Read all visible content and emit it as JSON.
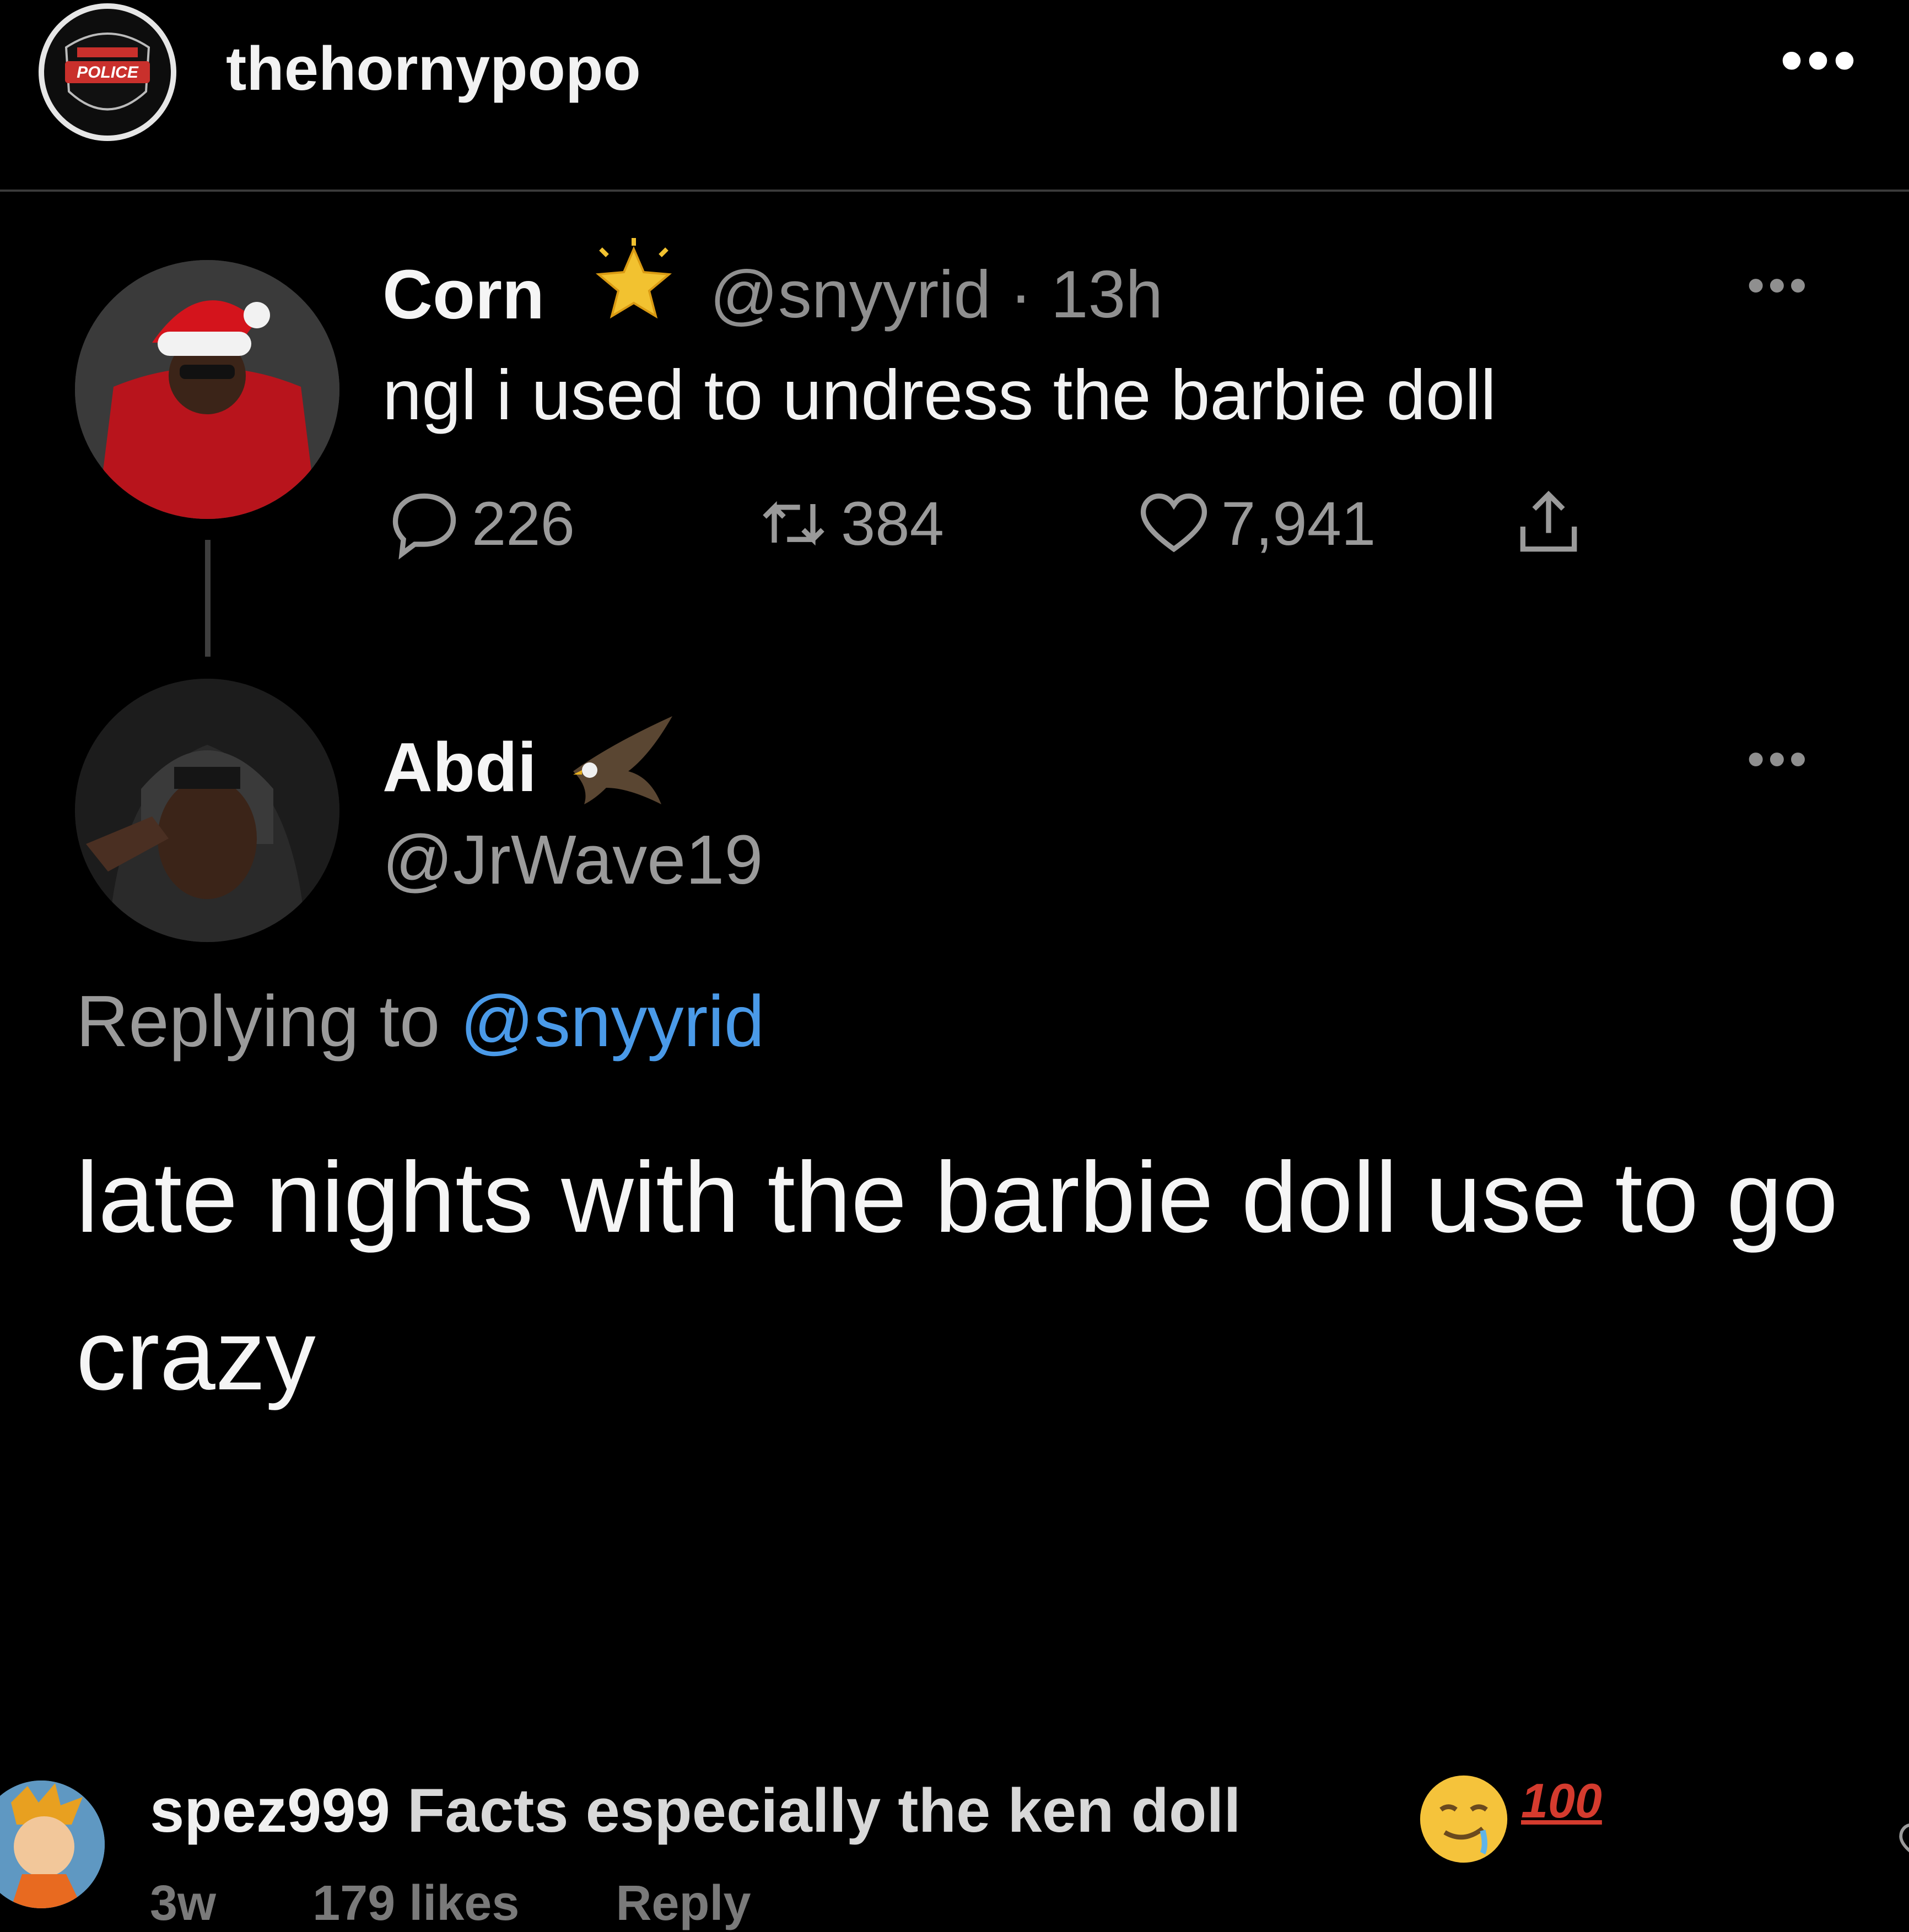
{
  "header": {
    "username": "thehornypopo",
    "avatar_icon": "police-badge-icon",
    "more_label": "•••"
  },
  "tweet1": {
    "display_name": "Corn",
    "badge_icon": "star-icon",
    "handle_time": "@snyyrid · 13h",
    "more_label": "•••",
    "text": "ngl i used to undress the barbie doll",
    "reply_count": "226",
    "retweet_count": "384",
    "like_count": "7,941",
    "share_icon": "share-icon"
  },
  "tweet2": {
    "display_name": "Abdi",
    "badge_icon": "eagle-icon",
    "handle": "@JrWave19",
    "more_label": "•••",
    "replying_prefix": "Replying to",
    "replying_handle": "@snyyrid",
    "text": "late nights with the barbie doll use to go crazy"
  },
  "comment": {
    "username": "spez999",
    "text": "Facts especially the ken doll",
    "emoji_icon": "drooling-face-emoji",
    "hundred_badge": "100",
    "age": "3w",
    "likes": "179 likes",
    "reply_label": "Reply"
  },
  "colors": {
    "background": "#000000",
    "link_blue": "#4a9ae8",
    "muted_gray": "#9a9a9a"
  }
}
